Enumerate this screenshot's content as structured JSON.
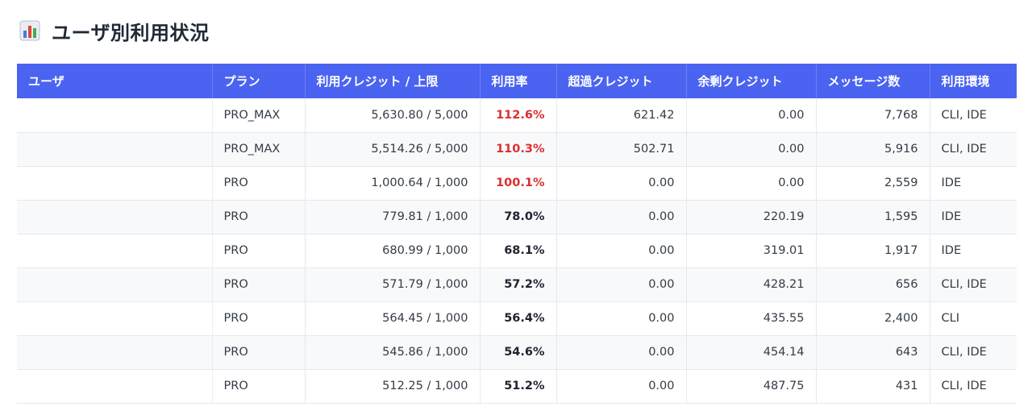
{
  "header": {
    "title": "ユーザ別利用状況",
    "icon": "bar-chart-icon"
  },
  "colors": {
    "header_bg": "#4a63f0",
    "over_limit": "#dc2f2f"
  },
  "table": {
    "columns": [
      "ユーザ",
      "プラン",
      "利用クレジット / 上限",
      "利用率",
      "超過クレジット",
      "余剰クレジット",
      "メッセージ数",
      "利用環境"
    ],
    "rows": [
      {
        "user": "",
        "plan": "PRO_MAX",
        "credits": "5,630.80 / 5,000",
        "rate": "112.6%",
        "over_limit": true,
        "excess": "621.42",
        "surplus": "0.00",
        "messages": "7,768",
        "env": "CLI, IDE"
      },
      {
        "user": "",
        "plan": "PRO_MAX",
        "credits": "5,514.26 / 5,000",
        "rate": "110.3%",
        "over_limit": true,
        "excess": "502.71",
        "surplus": "0.00",
        "messages": "5,916",
        "env": "CLI, IDE"
      },
      {
        "user": "",
        "plan": "PRO",
        "credits": "1,000.64 / 1,000",
        "rate": "100.1%",
        "over_limit": true,
        "excess": "0.00",
        "surplus": "0.00",
        "messages": "2,559",
        "env": "IDE"
      },
      {
        "user": "",
        "plan": "PRO",
        "credits": "779.81 / 1,000",
        "rate": "78.0%",
        "over_limit": false,
        "excess": "0.00",
        "surplus": "220.19",
        "messages": "1,595",
        "env": "IDE"
      },
      {
        "user": "",
        "plan": "PRO",
        "credits": "680.99 / 1,000",
        "rate": "68.1%",
        "over_limit": false,
        "excess": "0.00",
        "surplus": "319.01",
        "messages": "1,917",
        "env": "IDE"
      },
      {
        "user": "",
        "plan": "PRO",
        "credits": "571.79 / 1,000",
        "rate": "57.2%",
        "over_limit": false,
        "excess": "0.00",
        "surplus": "428.21",
        "messages": "656",
        "env": "CLI, IDE"
      },
      {
        "user": "",
        "plan": "PRO",
        "credits": "564.45 / 1,000",
        "rate": "56.4%",
        "over_limit": false,
        "excess": "0.00",
        "surplus": "435.55",
        "messages": "2,400",
        "env": "CLI"
      },
      {
        "user": "",
        "plan": "PRO",
        "credits": "545.86 / 1,000",
        "rate": "54.6%",
        "over_limit": false,
        "excess": "0.00",
        "surplus": "454.14",
        "messages": "643",
        "env": "CLI, IDE"
      },
      {
        "user": "",
        "plan": "PRO",
        "credits": "512.25 / 1,000",
        "rate": "51.2%",
        "over_limit": false,
        "excess": "0.00",
        "surplus": "487.75",
        "messages": "431",
        "env": "CLI, IDE"
      }
    ]
  }
}
